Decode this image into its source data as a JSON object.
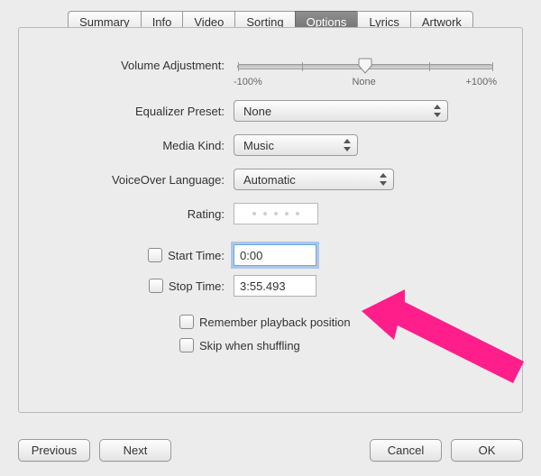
{
  "tabs": {
    "summary": "Summary",
    "info": "Info",
    "video": "Video",
    "sorting": "Sorting",
    "options": "Options",
    "lyrics": "Lyrics",
    "artwork": "Artwork",
    "selected": "options"
  },
  "labels": {
    "volume": "Volume Adjustment:",
    "eq": "Equalizer Preset:",
    "media": "Media Kind:",
    "voiceover": "VoiceOver Language:",
    "rating": "Rating:",
    "start": "Start Time:",
    "stop": "Stop Time:",
    "remember": "Remember playback position",
    "skip": "Skip when shuffling"
  },
  "slider": {
    "min_label": "-100%",
    "mid_label": "None",
    "max_label": "+100%",
    "value_pct": 50
  },
  "values": {
    "eq": "None",
    "media": "Music",
    "voiceover": "Automatic",
    "start_time": "0:00",
    "stop_time": "3:55.493"
  },
  "buttons": {
    "previous": "Previous",
    "next": "Next",
    "cancel": "Cancel",
    "ok": "OK"
  }
}
